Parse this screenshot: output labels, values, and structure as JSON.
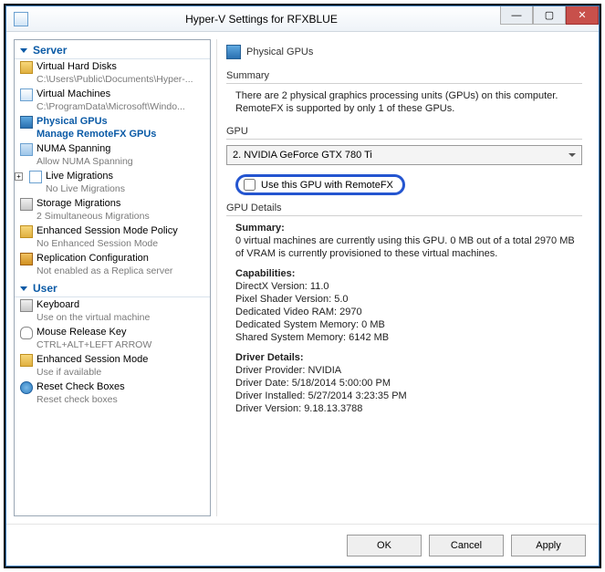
{
  "window": {
    "title": "Hyper-V Settings for RFXBLUE"
  },
  "nav": {
    "server_label": "Server",
    "user_label": "User",
    "items": {
      "vhd": {
        "label": "Virtual Hard Disks",
        "sub": "C:\\Users\\Public\\Documents\\Hyper-..."
      },
      "vms": {
        "label": "Virtual Machines",
        "sub": "C:\\ProgramData\\Microsoft\\Windo..."
      },
      "gpu": {
        "label": "Physical GPUs",
        "sub": "Manage RemoteFX GPUs"
      },
      "numa": {
        "label": "NUMA Spanning",
        "sub": "Allow NUMA Spanning"
      },
      "live": {
        "label": "Live Migrations",
        "sub": "No Live Migrations"
      },
      "storage": {
        "label": "Storage Migrations",
        "sub": "2 Simultaneous Migrations"
      },
      "sess": {
        "label": "Enhanced Session Mode Policy",
        "sub": "No Enhanced Session Mode"
      },
      "repl": {
        "label": "Replication Configuration",
        "sub": "Not enabled as a Replica server"
      },
      "kb": {
        "label": "Keyboard",
        "sub": "Use on the virtual machine"
      },
      "mouse": {
        "label": "Mouse Release Key",
        "sub": "CTRL+ALT+LEFT ARROW"
      },
      "esm": {
        "label": "Enhanced Session Mode",
        "sub": "Use if available"
      },
      "reset": {
        "label": "Reset Check Boxes",
        "sub": "Reset check boxes"
      }
    }
  },
  "right": {
    "header": "Physical GPUs",
    "summary_label": "Summary",
    "summary_text": "There are 2 physical graphics processing units (GPUs) on this computer. RemoteFX is supported by only 1 of these GPUs.",
    "gpu_label": "GPU",
    "gpu_selected": "2. NVIDIA GeForce GTX 780 Ti",
    "checkbox_label": "Use this GPU with RemoteFX",
    "details_label": "GPU Details",
    "details": {
      "summary_h": "Summary:",
      "summary": "0 virtual machines are currently using this GPU. 0 MB out of a total 2970 MB of VRAM is currently provisioned to these virtual machines.",
      "caps_h": "Capabilities:",
      "dx": "DirectX Version: 11.0",
      "ps": "Pixel Shader Version: 5.0",
      "vram": "Dedicated Video RAM: 2970",
      "dsm": "Dedicated System Memory: 0 MB",
      "ssm": "Shared System Memory: 6142 MB",
      "drv_h": "Driver Details:",
      "dp": "Driver Provider: NVIDIA",
      "dd": "Driver Date: 5/18/2014 5:00:00 PM",
      "di": "Driver Installed: 5/27/2014 3:23:35 PM",
      "dv": "Driver Version: 9.18.13.3788"
    }
  },
  "buttons": {
    "ok": "OK",
    "cancel": "Cancel",
    "apply": "Apply"
  }
}
